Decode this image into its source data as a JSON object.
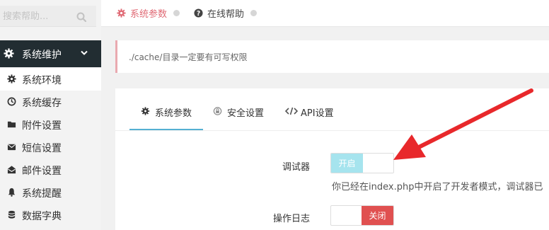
{
  "sidebar": {
    "search_placeholder": "搜索帮助...",
    "group": {
      "label": "系统维护",
      "icon": "gear-icon"
    },
    "items": [
      {
        "label": "系统环境",
        "icon": "gear-icon",
        "active": true
      },
      {
        "label": "系统缓存",
        "icon": "clock-icon"
      },
      {
        "label": "附件设置",
        "icon": "folder-icon"
      },
      {
        "label": "短信设置",
        "icon": "envelope-icon"
      },
      {
        "label": "邮件设置",
        "icon": "envelope-open-icon"
      },
      {
        "label": "系统提醒",
        "icon": "bell-icon"
      },
      {
        "label": "数据字典",
        "icon": "database-icon"
      }
    ]
  },
  "topbar": {
    "tabs": [
      {
        "label": "系统参数",
        "icon": "gear-icon",
        "active": true
      },
      {
        "label": "在线帮助",
        "icon": "question-circle-icon"
      }
    ]
  },
  "alert": {
    "text": "./cache/目录一定要有可写权限"
  },
  "panel": {
    "tabs": [
      {
        "label": "系统参数",
        "icon": "gear-icon",
        "active": true
      },
      {
        "label": "安全设置",
        "icon": "lock-icon"
      },
      {
        "label": "API设置",
        "icon": "code-icon"
      }
    ],
    "fields": [
      {
        "label": "调试器",
        "toggle_on_label": "开启",
        "state": "on",
        "help": "你已经在index.php中开启了开发者模式，调试器已"
      },
      {
        "label": "操作日志",
        "toggle_off_label": "关闭",
        "state": "off"
      }
    ]
  },
  "colors": {
    "sidebar_group_bg": "#222d32",
    "active_tab": "#e06a75",
    "toggle_on": "#a6e4ee",
    "toggle_off": "#e05050",
    "tab_underline": "#55b0d3",
    "arrow": "#e8282b"
  }
}
